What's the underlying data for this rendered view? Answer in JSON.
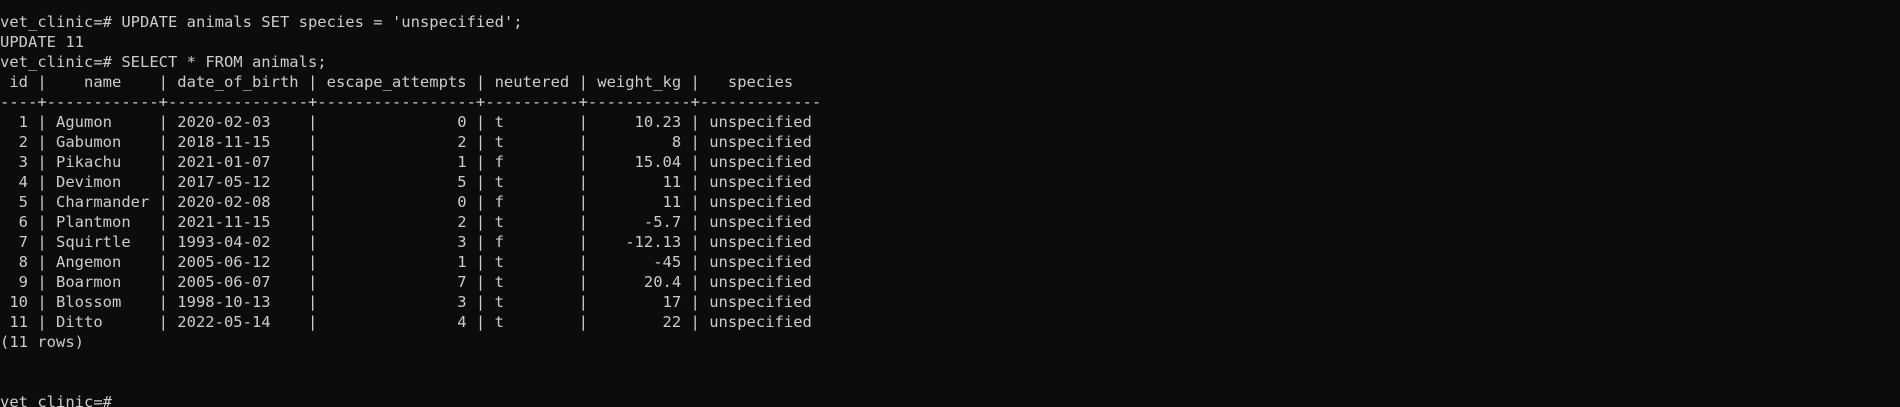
{
  "terminal": {
    "lines": [
      {
        "kind": "command",
        "prompt": "vet_clinic=# ",
        "text": "UPDATE animals SET species = 'unspecified';"
      },
      {
        "kind": "output",
        "text": "UPDATE 11"
      },
      {
        "kind": "command",
        "prompt": "vet_clinic=# ",
        "text": "SELECT * FROM animals;"
      }
    ],
    "table": {
      "header": " id |    name    | date_of_birth | escape_attempts | neutered | weight_kg |   species",
      "separator": "----+------------+---------------+-----------------+----------+-----------+-------------",
      "columns": [
        "id",
        "name",
        "date_of_birth",
        "escape_attempts",
        "neutered",
        "weight_kg",
        "species"
      ],
      "rows": [
        [
          "1",
          "Agumon",
          "2020-02-03",
          "0",
          "t",
          "10.23",
          "unspecified"
        ],
        [
          "2",
          "Gabumon",
          "2018-11-15",
          "2",
          "t",
          "8",
          "unspecified"
        ],
        [
          "3",
          "Pikachu",
          "2021-01-07",
          "1",
          "f",
          "15.04",
          "unspecified"
        ],
        [
          "4",
          "Devimon",
          "2017-05-12",
          "5",
          "t",
          "11",
          "unspecified"
        ],
        [
          "5",
          "Charmander",
          "2020-02-08",
          "0",
          "f",
          "11",
          "unspecified"
        ],
        [
          "6",
          "Plantmon",
          "2021-11-15",
          "2",
          "t",
          "-5.7",
          "unspecified"
        ],
        [
          "7",
          "Squirtle",
          "1993-04-02",
          "3",
          "f",
          "-12.13",
          "unspecified"
        ],
        [
          "8",
          "Angemon",
          "2005-06-12",
          "1",
          "t",
          "-45",
          "unspecified"
        ],
        [
          "9",
          "Boarmon",
          "2005-06-07",
          "7",
          "t",
          "20.4",
          "unspecified"
        ],
        [
          "10",
          "Blossom",
          "1998-10-13",
          "3",
          "t",
          "17",
          "unspecified"
        ],
        [
          "11",
          "Ditto",
          "2022-05-14",
          "4",
          "t",
          "22",
          "unspecified"
        ]
      ],
      "footer": "(11 rows)"
    },
    "final_prompt": "vet_clinic=# ",
    "colors": {
      "background": "#0c0c0c",
      "text": "#cccccc"
    }
  }
}
